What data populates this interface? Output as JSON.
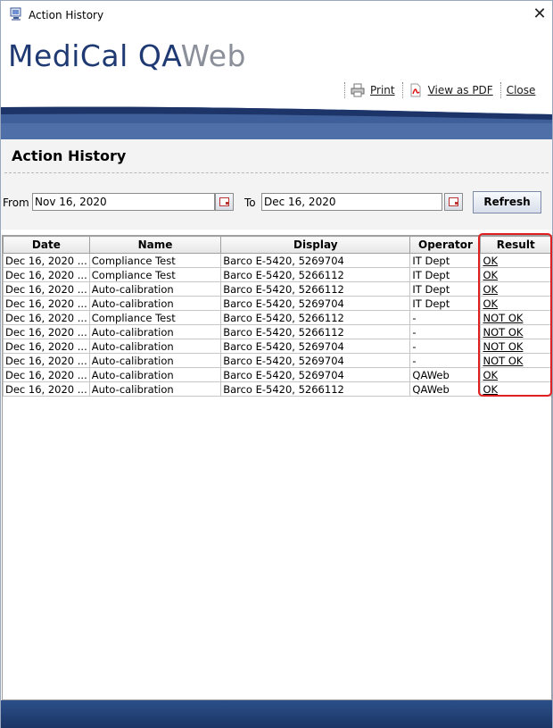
{
  "window": {
    "title": "Action History"
  },
  "header": {
    "logo_main": "MediCal QA",
    "logo_accent": "Web",
    "links": {
      "print": "Print",
      "pdf": "View as PDF",
      "close": "Close"
    }
  },
  "section": {
    "title": "Action History"
  },
  "filter": {
    "from_label": "From",
    "from_value": "Nov 16, 2020",
    "to_label": "To",
    "to_value": "Dec 16, 2020",
    "refresh_label": "Refresh"
  },
  "table": {
    "columns": [
      "Date",
      "Name",
      "Display",
      "Operator",
      "Result"
    ],
    "rows": [
      [
        "Dec 16, 2020 ...",
        "Compliance Test",
        "Barco E-5420, 5269704",
        "IT Dept",
        "OK"
      ],
      [
        "Dec 16, 2020 ...",
        "Compliance Test",
        "Barco E-5420, 5266112",
        "IT Dept",
        "OK"
      ],
      [
        "Dec 16, 2020 ...",
        "Auto-calibration",
        "Barco E-5420, 5266112",
        "IT Dept",
        "OK"
      ],
      [
        "Dec 16, 2020 ...",
        "Auto-calibration",
        "Barco E-5420, 5269704",
        "IT Dept",
        "OK"
      ],
      [
        "Dec 16, 2020 ...",
        "Compliance Test",
        "Barco E-5420, 5266112",
        "-",
        "NOT OK"
      ],
      [
        "Dec 16, 2020 ...",
        "Auto-calibration",
        "Barco E-5420, 5266112",
        "-",
        "NOT OK"
      ],
      [
        "Dec 16, 2020 ...",
        "Auto-calibration",
        "Barco E-5420, 5269704",
        "-",
        "NOT OK"
      ],
      [
        "Dec 16, 2020 ...",
        "Auto-calibration",
        "Barco E-5420, 5269704",
        "-",
        "NOT OK"
      ],
      [
        "Dec 16, 2020 ...",
        "Auto-calibration",
        "Barco E-5420, 5269704",
        "QAWeb",
        "OK"
      ],
      [
        "Dec 16, 2020 ...",
        "Auto-calibration",
        "Barco E-5420, 5266112",
        "QAWeb",
        "OK"
      ]
    ]
  },
  "colors": {
    "brand_blue": "#1f3a73",
    "highlight": "#e02020"
  }
}
